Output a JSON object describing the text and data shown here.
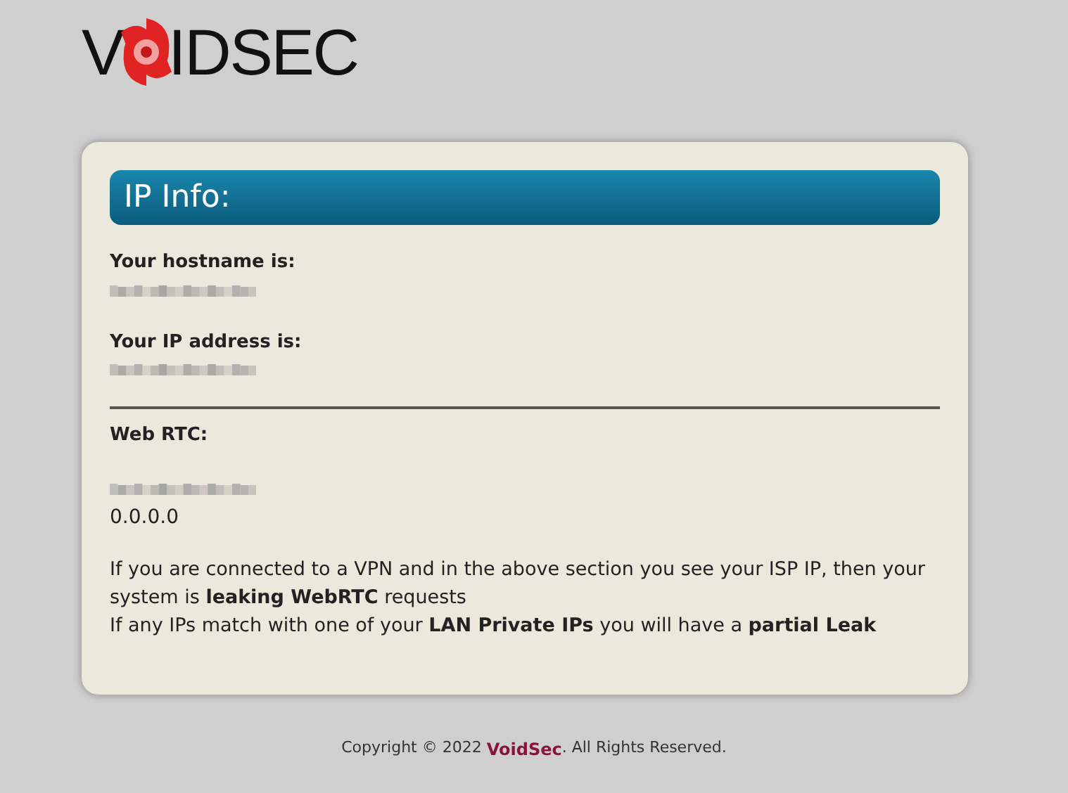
{
  "logo": {
    "before": "V",
    "after": "IDSEC"
  },
  "card": {
    "title": "IP Info:",
    "fields": [
      {
        "label": "Your hostname is:",
        "value": {
          "kind": "redacted"
        }
      },
      {
        "label": "Your IP address is:",
        "value": {
          "kind": "redacted"
        }
      }
    ],
    "webrtc": {
      "label": "Web RTC:",
      "values": [
        {
          "kind": "redacted"
        },
        {
          "kind": "text",
          "text": "0.0.0.0"
        }
      ]
    },
    "notes": [
      "If you are connected to a VPN and in the above section you see your ISP IP, then your system is **leaking WebRTC** requests",
      "If any IPs match with one of your **LAN Private IPs** you will have a **partial Leak**"
    ]
  },
  "footer": {
    "prefix": "Copyright © 2022 ",
    "link": "VoidSec",
    "suffix": ". All Rights Reserved."
  }
}
